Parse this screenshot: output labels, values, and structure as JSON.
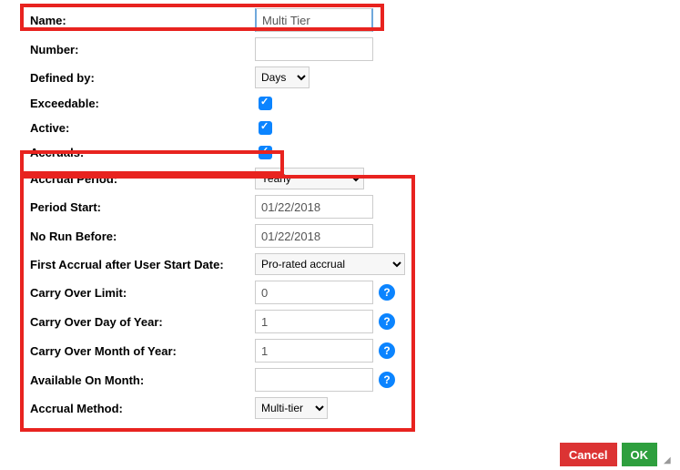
{
  "fields": {
    "name": {
      "label": "Name:",
      "value": "Multi Tier"
    },
    "number": {
      "label": "Number:",
      "value": ""
    },
    "defined_by": {
      "label": "Defined by:",
      "value": "Days"
    },
    "exceedable": {
      "label": "Exceedable:"
    },
    "active": {
      "label": "Active:"
    },
    "accruals": {
      "label": "Accruals:"
    },
    "accrual_period": {
      "label": "Accrual Period:",
      "value": "Yearly"
    },
    "period_start": {
      "label": "Period Start:",
      "value": "01/22/2018"
    },
    "no_run_before": {
      "label": "No Run Before:",
      "value": "01/22/2018"
    },
    "first_accrual": {
      "label": "First Accrual after User Start Date:",
      "value": "Pro-rated accrual"
    },
    "carry_over_limit": {
      "label": "Carry Over Limit:",
      "value": "0"
    },
    "carry_over_day": {
      "label": "Carry Over Day of Year:",
      "value": "1"
    },
    "carry_over_month": {
      "label": "Carry Over Month of Year:",
      "value": "1"
    },
    "available_on_month": {
      "label": "Available On Month:",
      "value": ""
    },
    "accrual_method": {
      "label": "Accrual Method:",
      "value": "Multi-tier"
    }
  },
  "help_glyph": "?",
  "buttons": {
    "cancel": "Cancel",
    "ok": "OK"
  }
}
